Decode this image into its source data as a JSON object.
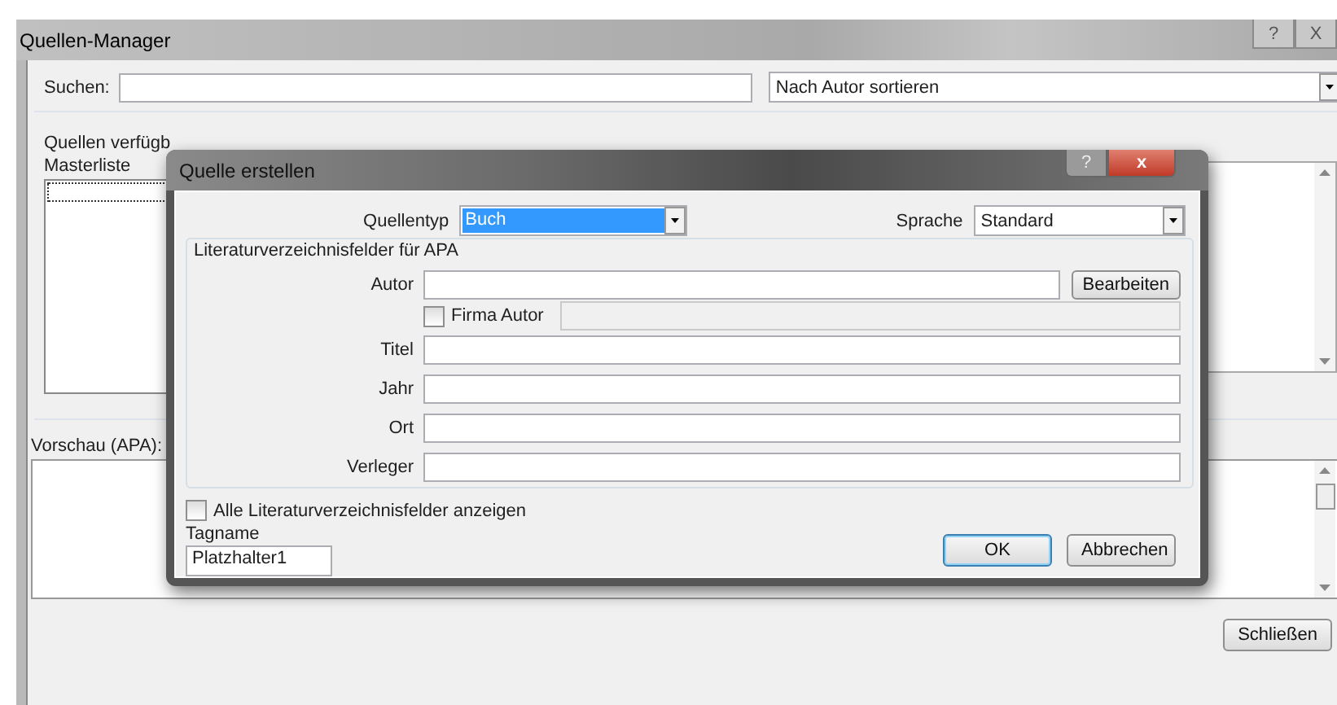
{
  "window": {
    "title": "Quellen-Manager",
    "title_buttons": [
      "?",
      "X"
    ]
  },
  "search": {
    "label": "Suchen:"
  },
  "sort": {
    "value": "Nach Autor sortieren"
  },
  "sources": {
    "label": "Quellen verfügb",
    "list_title": "Masterliste"
  },
  "preview": {
    "label": "Vorschau (APA):"
  },
  "close_button": "Schließen",
  "dialog": {
    "title": "Quelle erstellen",
    "title_buttons": [
      "?",
      "x"
    ],
    "source_type": {
      "label": "Quellentyp",
      "value": "Buch"
    },
    "language": {
      "label": "Sprache",
      "value": "Standard"
    },
    "group_title": "Literaturverzeichnisfelder für APA",
    "fields": [
      {
        "kind": "text_edit",
        "label": "Autor",
        "button": "Bearbeiten"
      },
      {
        "kind": "checkbox",
        "label": "Firma Autor",
        "checked": false
      },
      {
        "kind": "text",
        "label": "Titel"
      },
      {
        "kind": "text",
        "label": "Jahr"
      },
      {
        "kind": "text",
        "label": "Ort"
      },
      {
        "kind": "text",
        "label": "Verleger"
      }
    ],
    "show_all": {
      "label": "Alle Literaturverzeichnisfelder anzeigen",
      "checked": false
    },
    "tag_name": {
      "label": "Tagname",
      "value": "Platzhalter1"
    },
    "buttons": [
      {
        "label": "OK",
        "default": true
      },
      {
        "label": "Abbrechen",
        "default": false
      }
    ]
  }
}
